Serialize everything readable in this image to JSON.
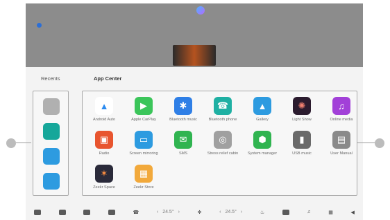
{
  "header": {
    "left_status": [
      "",
      "",
      "",
      "",
      ""
    ],
    "right_status": [
      "",
      "",
      ""
    ],
    "sub_left": "",
    "sub_right": ""
  },
  "recents": {
    "title": "Recents",
    "items": [
      {
        "icon": "circle-icon",
        "color": "#b0b0b0"
      },
      {
        "icon": "phone-icon",
        "color": "#16a79a"
      },
      {
        "icon": "gallery-icon",
        "color": "#2d9be0"
      },
      {
        "icon": "screen-mirroring-icon",
        "color": "#2d9be0"
      }
    ]
  },
  "app_center": {
    "title": "App Center",
    "apps": [
      {
        "label": "Android Auto",
        "icon": "android-auto-icon",
        "bg": "#ffffff",
        "fg": "#2c8bf0",
        "glyph": "▲"
      },
      {
        "label": "Apple CarPlay",
        "icon": "apple-carplay-icon",
        "bg": "#3bc55a",
        "fg": "#ffffff",
        "glyph": "▶"
      },
      {
        "label": "Bluetooth music",
        "icon": "bluetooth-icon",
        "bg": "#2f7fe6",
        "fg": "#ffffff",
        "glyph": "✱"
      },
      {
        "label": "Bluetooth phone",
        "icon": "bluetooth-phone-icon",
        "bg": "#1fb0a3",
        "fg": "#ffffff",
        "glyph": "☎"
      },
      {
        "label": "Gallery",
        "icon": "gallery-icon",
        "bg": "#2d9be0",
        "fg": "#ffffff",
        "glyph": "▲"
      },
      {
        "label": "Light Show",
        "icon": "light-show-icon",
        "bg": "#2b1b2e",
        "fg": "#f08070",
        "glyph": "✺"
      },
      {
        "label": "Online media",
        "icon": "music-note-icon",
        "bg": "#a240d8",
        "fg": "#ffffff",
        "glyph": "♫"
      },
      {
        "label": "Radio",
        "icon": "radio-icon",
        "bg": "#e8552f",
        "fg": "#ffffff",
        "glyph": "▣"
      },
      {
        "label": "Screen mirroring",
        "icon": "screen-mirroring-icon",
        "bg": "#2d9be0",
        "fg": "#ffffff",
        "glyph": "▭"
      },
      {
        "label": "SMS",
        "icon": "sms-icon",
        "bg": "#30b450",
        "fg": "#ffffff",
        "glyph": "✉"
      },
      {
        "label": "Stress relief cabin",
        "icon": "stress-relief-icon",
        "bg": "#a0a0a0",
        "fg": "#ffffff",
        "glyph": "◎"
      },
      {
        "label": "System manager",
        "icon": "system-manager-icon",
        "bg": "#30b450",
        "fg": "#ffffff",
        "glyph": "⬢"
      },
      {
        "label": "USB music",
        "icon": "usb-icon",
        "bg": "#6a6a6a",
        "fg": "#ffffff",
        "glyph": "▮"
      },
      {
        "label": "User Manual",
        "icon": "manual-icon",
        "bg": "#8a8a8a",
        "fg": "#ffffff",
        "glyph": "▤"
      },
      {
        "label": "Zeekr Space",
        "icon": "zeekr-space-icon",
        "bg": "#2a2a3a",
        "fg": "#ff8f40",
        "glyph": "✶"
      },
      {
        "label": "Zeekr Store",
        "icon": "zeekr-store-icon",
        "bg": "#f2a93b",
        "fg": "#ffffff",
        "glyph": "▦"
      }
    ]
  },
  "bottom_bar": {
    "temp_left": "24.5°",
    "temp_right": "24.5°"
  },
  "callouts": {
    "left": "",
    "right": ""
  }
}
